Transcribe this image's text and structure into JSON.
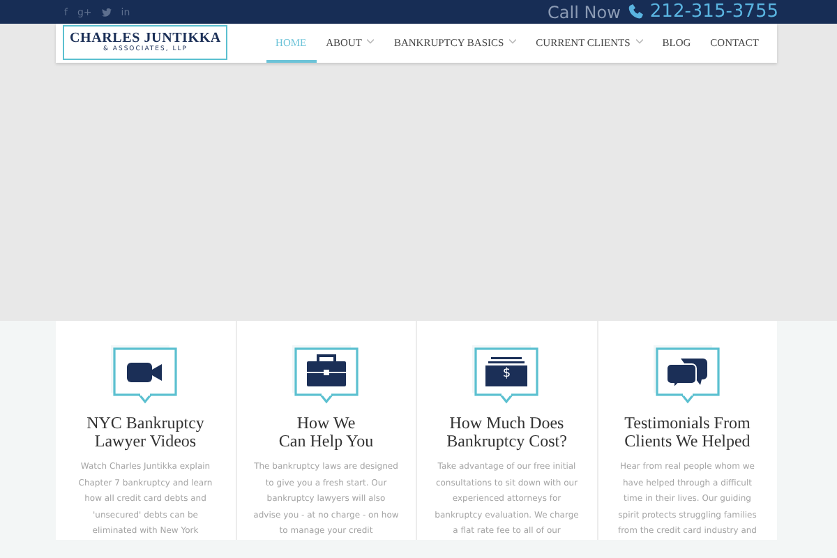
{
  "top_bar": {
    "social": [
      {
        "kind": "text",
        "label": "f"
      },
      {
        "kind": "text",
        "label": "g+"
      },
      {
        "kind": "bird"
      },
      {
        "kind": "text",
        "label": "in"
      }
    ],
    "call_label": "Call Now",
    "phone": "212-315-3755"
  },
  "logo": {
    "name": "CHARLES JUNTIKKA",
    "subtitle": "& ASSOCIATES, LLP"
  },
  "nav": [
    {
      "label": "HOME",
      "selected": true,
      "has_dropdown": false
    },
    {
      "label": "ABOUT",
      "selected": false,
      "has_dropdown": true
    },
    {
      "label": "BANKRUPTCY BASICS",
      "selected": false,
      "has_dropdown": true
    },
    {
      "label": "CURRENT CLIENTS",
      "selected": false,
      "has_dropdown": true
    },
    {
      "label": "BLOG",
      "selected": false,
      "has_dropdown": false
    },
    {
      "label": "CONTACT",
      "selected": false,
      "has_dropdown": false
    }
  ],
  "features": [
    {
      "kind": "video",
      "title": "NYC Bankruptcy\nLawyer Videos",
      "text": "Watch Charles Juntikka explain Chapter 7 bankruptcy and learn how all credit card debts and 'unsecured' debts can be eliminated with New York"
    },
    {
      "kind": "briefcase",
      "title": "How We\nCan Help You",
      "text": "The bankruptcy laws are designed to give you a fresh start. Our bankruptcy lawyers will also advise you - at no charge - on how to manage your credit"
    },
    {
      "kind": "money",
      "symbol": "$",
      "title": "How Much Does\nBankruptcy Cost?",
      "text": "Take advantage of our free initial consultations to sit down with our experienced attorneys for bankruptcy evaluation. We charge a flat rate fee to all of our"
    },
    {
      "kind": "chat",
      "title": "Testimonials From\nClients We Helped",
      "text": "Hear from real people whom we have helped through a difficult time in their lives. Our guiding spirit protects struggling families from the credit card industry and"
    }
  ]
}
